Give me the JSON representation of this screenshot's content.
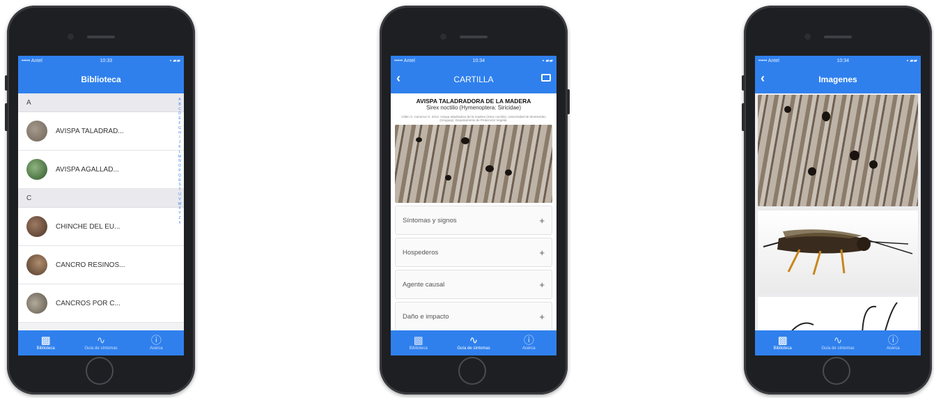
{
  "phone1": {
    "status": {
      "carrier": "••••• Antel",
      "time": "10:33",
      "battery": "▪ ▰▰"
    },
    "title": "Biblioteca",
    "sections": [
      {
        "letter": "A",
        "items": [
          "AVISPA TALADRAD...",
          "AVISPA AGALLAD..."
        ]
      },
      {
        "letter": "C",
        "items": [
          "CHINCHE DEL EU...",
          "CANCRO RESINOS...",
          "CANCROS POR C..."
        ]
      }
    ],
    "index_letters": [
      "A",
      "B",
      "C",
      "D",
      "E",
      "F",
      "G",
      "H",
      "I",
      "J",
      "K",
      "L",
      "M",
      "N",
      "O",
      "P",
      "Q",
      "R",
      "S",
      "T",
      "U",
      "V",
      "W",
      "X",
      "Y",
      "Z",
      "#"
    ],
    "thumb_colors": [
      "#7d7468",
      "#3f6b39",
      "#6a4a3a",
      "#5c4536",
      "#8a8172"
    ]
  },
  "phone2": {
    "status": {
      "carrier": "••••• Antel",
      "time": "10:34",
      "battery": "▪ ▰▰"
    },
    "title": "CARTILLA",
    "heading": "AVISPA TALADRADORA DE LA MADERA",
    "subheading": "Sirex noctilio (Hymenoptera: Siricidae)",
    "note": "Gillen S. Cameron S. 2014. Avispa taladradora de la madera (Sirex noctilio). Universidad de Montevideo (Uruguay). Departamento de Protección Vegetal.",
    "accordion": [
      "Síntomas y signos",
      "Hospederos",
      "Agente causal",
      "Daño e impacto"
    ],
    "plus": "+"
  },
  "phone3": {
    "status": {
      "carrier": "••••• Antel",
      "time": "10:34",
      "battery": "▪ ▰▰"
    },
    "title": "Imagenes"
  },
  "tabs": [
    {
      "icon": "book-icon",
      "glyph": "📖",
      "label": "Biblioteca"
    },
    {
      "icon": "pulse-icon",
      "glyph": "〰",
      "label": "Guía de síntomas"
    },
    {
      "icon": "info-icon",
      "glyph": "ⓘ",
      "label": "Acerca"
    }
  ],
  "colors": {
    "accent": "#2f80ed"
  }
}
